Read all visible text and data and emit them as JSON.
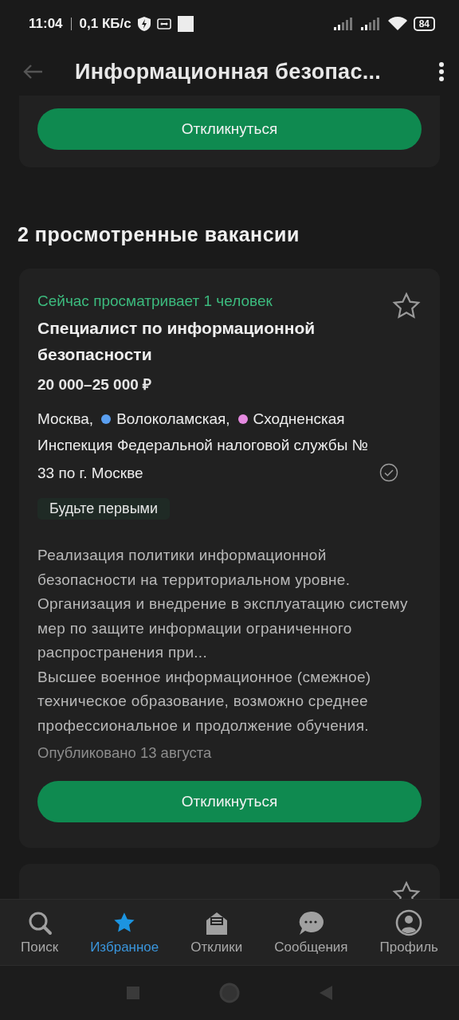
{
  "status_bar": {
    "time": "11:04",
    "speed": "0,1 КБ/с",
    "battery": "84"
  },
  "app_bar": {
    "title": "Информационная безопас..."
  },
  "top_card": {
    "button": "Откликнуться"
  },
  "section_title": "2 просмотренные вакансии",
  "vacancies": [
    {
      "viewers": "Сейчас просматривает 1 человек",
      "favorite": false,
      "title": "Специалист по информационной безопасности",
      "salary": "20 000–25 000 ₽",
      "city": "Москва,",
      "metro": [
        {
          "name": "Волоколамская,",
          "color": "#5a9ff0"
        },
        {
          "name": "Сходненская",
          "color": "#e58ae0"
        }
      ],
      "employer": "Инспекция Федеральной налоговой службы № 33 по г. Москве",
      "verified": true,
      "tag": "Будьте первыми",
      "description": "Реализация политики информационной безопасности на территориальном уровне. Организация и внедрение в эксплуатацию систему мер по защите информации ограниченного распространения при...",
      "requirements": "Высшее военное информационное (смежное) техническое образование, возможно среднее профессиональное и продолжение обучения.",
      "published": "Опубликовано 13 августа",
      "button": "Откликнуться"
    },
    {
      "favorite": false
    }
  ],
  "bottom_nav": [
    {
      "label": "Поиск",
      "selected": false
    },
    {
      "label": "Избранное",
      "selected": true
    },
    {
      "label": "Отклики",
      "selected": false
    },
    {
      "label": "Сообщения",
      "selected": false
    },
    {
      "label": "Профиль",
      "selected": false
    }
  ]
}
